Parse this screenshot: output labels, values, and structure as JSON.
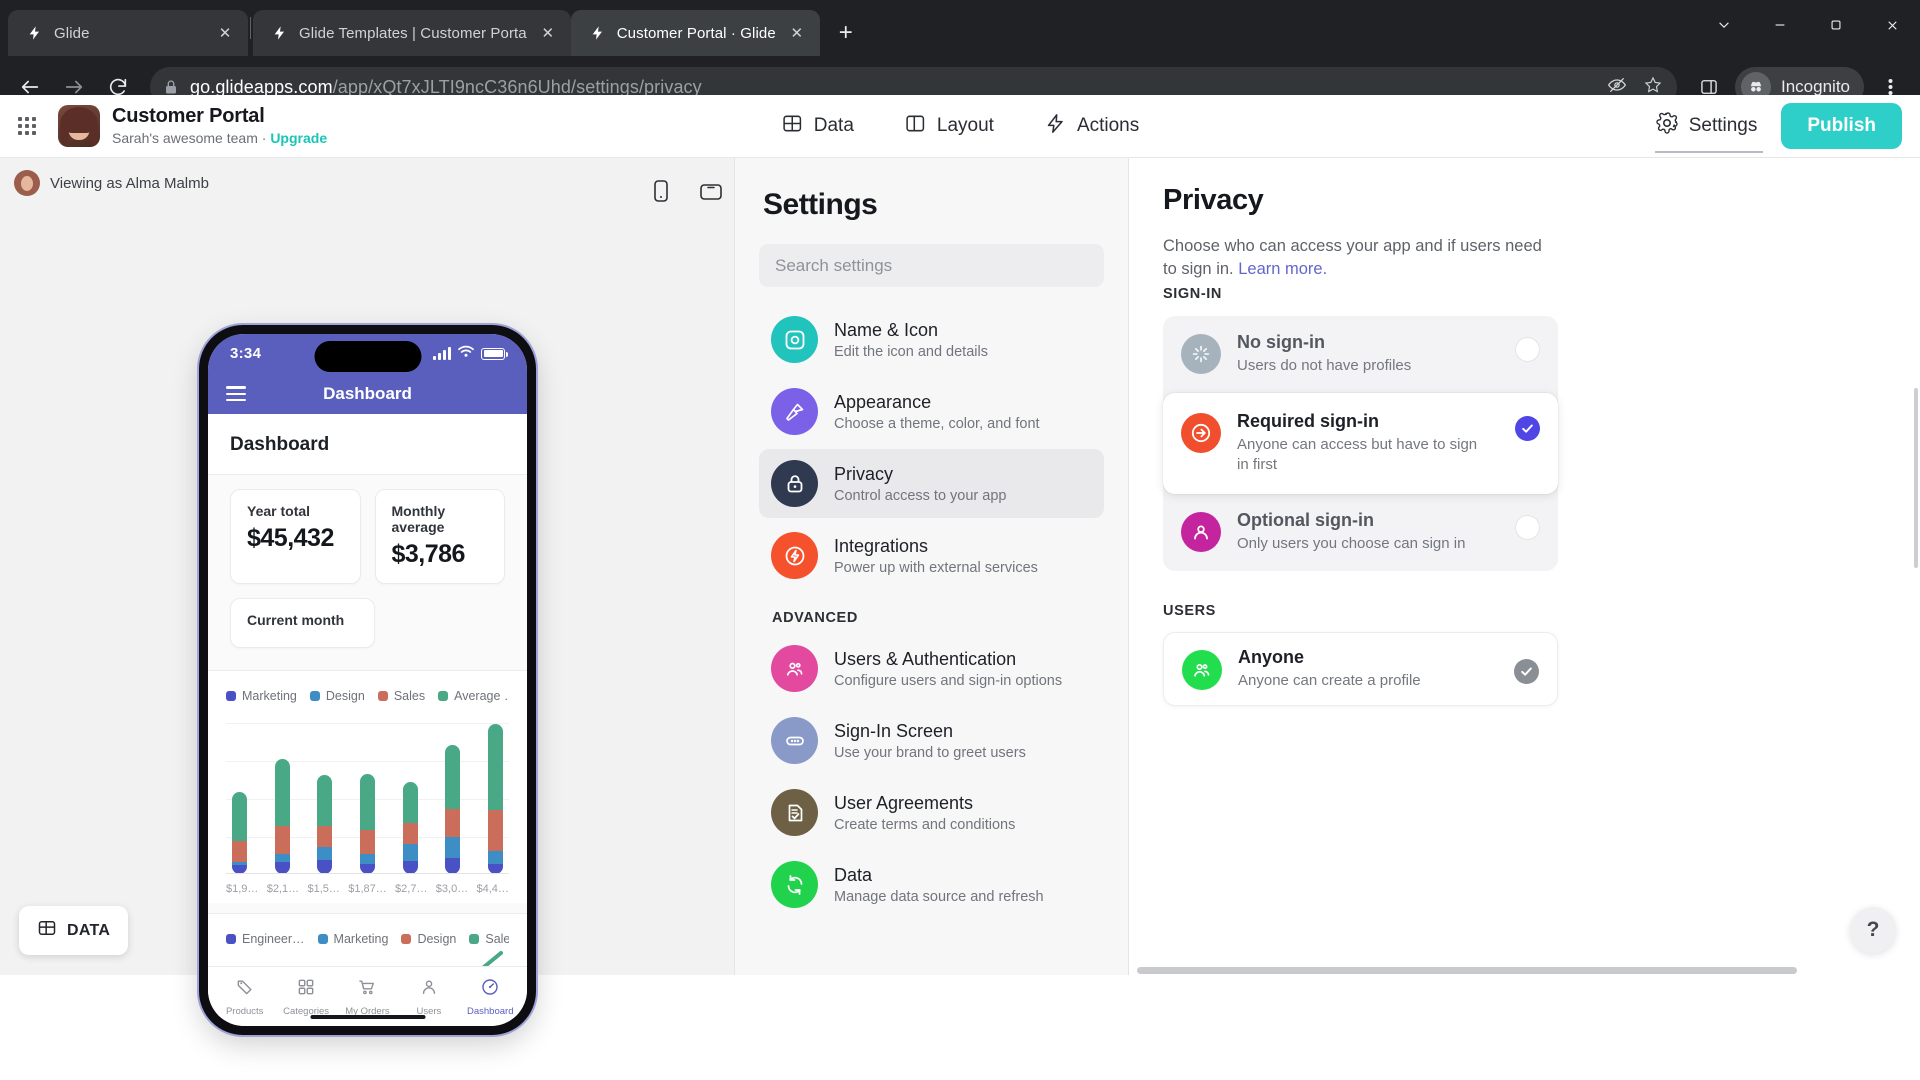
{
  "browser": {
    "tabs": [
      {
        "title": "Glide",
        "active": false,
        "favicon": "glide-bolt-icon"
      },
      {
        "title": "Glide Templates | Customer Porta",
        "active": false,
        "favicon": "glide-bolt-icon"
      },
      {
        "title": "Customer Portal · Glide",
        "active": true,
        "favicon": "glide-bolt-icon"
      }
    ],
    "new_tab_label": "+",
    "window_controls": [
      "chevron-down-icon",
      "minimize-icon",
      "maximize-icon",
      "close-icon"
    ],
    "url_host": "go.glideapps.com",
    "url_path": "/app/xQt7xJLTI9ncC36n6Uhd/settings/privacy",
    "profile_label": "Incognito",
    "omnibox_icons": [
      "no-tracking-icon",
      "bookmark-star-icon",
      "side-panel-icon"
    ],
    "menu_icon": "kebab-menu-icon"
  },
  "app_header": {
    "title": "Customer Portal",
    "team": "Sarah's awesome team",
    "separator": "·",
    "upgrade_label": "Upgrade",
    "nav": [
      {
        "label": "Data",
        "icon": "table-icon"
      },
      {
        "label": "Layout",
        "icon": "layout-icon"
      },
      {
        "label": "Actions",
        "icon": "bolt-icon"
      }
    ],
    "settings_label": "Settings",
    "publish_label": "Publish"
  },
  "preview": {
    "viewing_as": "Viewing as Alma Malmb",
    "device_toggles": [
      "phone-device-icon",
      "tablet-device-icon"
    ],
    "data_button_label": "DATA",
    "phone": {
      "status_time": "3:34",
      "app_bar_title": "Dashboard",
      "page_title": "Dashboard",
      "stats": [
        {
          "label": "Year total",
          "value": "$45,432"
        },
        {
          "label": "Monthly average",
          "value": "$3,786"
        }
      ],
      "stat_solo": {
        "label": "Current month",
        "value": ""
      },
      "tabs": [
        {
          "label": "Products",
          "icon": "tag-icon",
          "active": false
        },
        {
          "label": "Categories",
          "icon": "grid-icon",
          "active": false
        },
        {
          "label": "My Orders",
          "icon": "cart-icon",
          "active": false
        },
        {
          "label": "Users",
          "icon": "person-icon",
          "active": false
        },
        {
          "label": "Dashboard",
          "icon": "gauge-icon",
          "active": true
        }
      ]
    }
  },
  "chart_data": [
    {
      "type": "bar",
      "title": "",
      "stacked": true,
      "categories": [
        "$1,9…",
        "$2,1…",
        "$1,5…",
        "$1,87…",
        "$2,7…",
        "$3,0…",
        "$4,4…"
      ],
      "series": [
        {
          "name": "Marketing",
          "color": "#4a51c4",
          "values": [
            9,
            13,
            15,
            11,
            14,
            17,
            10
          ]
        },
        {
          "name": "Design",
          "color": "#3d8ec4",
          "values": [
            4,
            8,
            14,
            10,
            18,
            22,
            14
          ]
        },
        {
          "name": "Sales",
          "color": "#cb6d5b",
          "values": [
            22,
            30,
            22,
            26,
            22,
            30,
            44
          ]
        },
        {
          "name": "Average …",
          "color": "#49a886",
          "values": [
            52,
            72,
            54,
            60,
            44,
            68,
            92
          ]
        }
      ],
      "xlabel": "",
      "ylabel": "",
      "grid": true,
      "legend_position": "top"
    },
    {
      "type": "line",
      "title": "",
      "categories": [],
      "series": [
        {
          "name": "Engineer…",
          "color": "#4a51c4",
          "values": []
        },
        {
          "name": "Marketing",
          "color": "#3d8ec4",
          "values": []
        },
        {
          "name": "Design",
          "color": "#cb6d5b",
          "values": []
        },
        {
          "name": "Sales",
          "color": "#49a886",
          "values": []
        }
      ],
      "grid": true,
      "legend_position": "top"
    }
  ],
  "settings": {
    "heading": "Settings",
    "search_placeholder": "Search settings",
    "items": [
      {
        "title": "Name & Icon",
        "desc": "Edit the icon and details",
        "color": "#21c3bd",
        "icon": "image-frame-icon",
        "active": false
      },
      {
        "title": "Appearance",
        "desc": "Choose a theme, color, and font",
        "color": "#7b61e8",
        "icon": "paint-roller-icon",
        "active": false
      },
      {
        "title": "Privacy",
        "desc": "Control access to your app",
        "color": "#2f3a50",
        "icon": "lock-icon",
        "active": true
      },
      {
        "title": "Integrations",
        "desc": "Power up with external services",
        "color": "#f4512c",
        "icon": "bolt-circle-icon",
        "active": false
      }
    ],
    "advanced_label": "ADVANCED",
    "advanced_items": [
      {
        "title": "Users & Authentication",
        "desc": "Configure users and sign-in options",
        "color": "#e2499f",
        "icon": "people-icon",
        "active": false
      },
      {
        "title": "Sign-In Screen",
        "desc": "Use your brand to greet users",
        "color": "#8a9ac8",
        "icon": "password-dots-icon",
        "active": false
      },
      {
        "title": "User Agreements",
        "desc": "Create terms and conditions",
        "color": "#6e6044",
        "icon": "document-check-icon",
        "active": false
      },
      {
        "title": "Data",
        "desc": "Manage data source and refresh",
        "color": "#21d24c",
        "icon": "refresh-icon",
        "active": false
      }
    ]
  },
  "privacy": {
    "heading": "Privacy",
    "description": "Choose who can access your app and if users need to sign in. ",
    "learn_more": "Learn more.",
    "signin_label": "SIGN-IN",
    "signin_options": [
      {
        "title": "No sign-in",
        "desc": "Users do not have profiles",
        "color": "#a6b3bd",
        "icon": "spinner-icon",
        "selected": false
      },
      {
        "title": "Required sign-in",
        "desc": "Anyone can access but have to sign in first",
        "color": "#f04e2c",
        "icon": "arrow-right-circle-icon",
        "selected": true
      },
      {
        "title": "Optional sign-in",
        "desc": "Only users you choose can sign in",
        "color": "#c4249e",
        "icon": "person-circle-icon",
        "selected": false
      }
    ],
    "users_label": "USERS",
    "users_option": {
      "title": "Anyone",
      "desc": "Anyone can create a profile",
      "color": "#22dd4e",
      "icon": "people-icon",
      "checked": true
    },
    "help_label": "?",
    "accent_selected": "#4f46e5"
  }
}
